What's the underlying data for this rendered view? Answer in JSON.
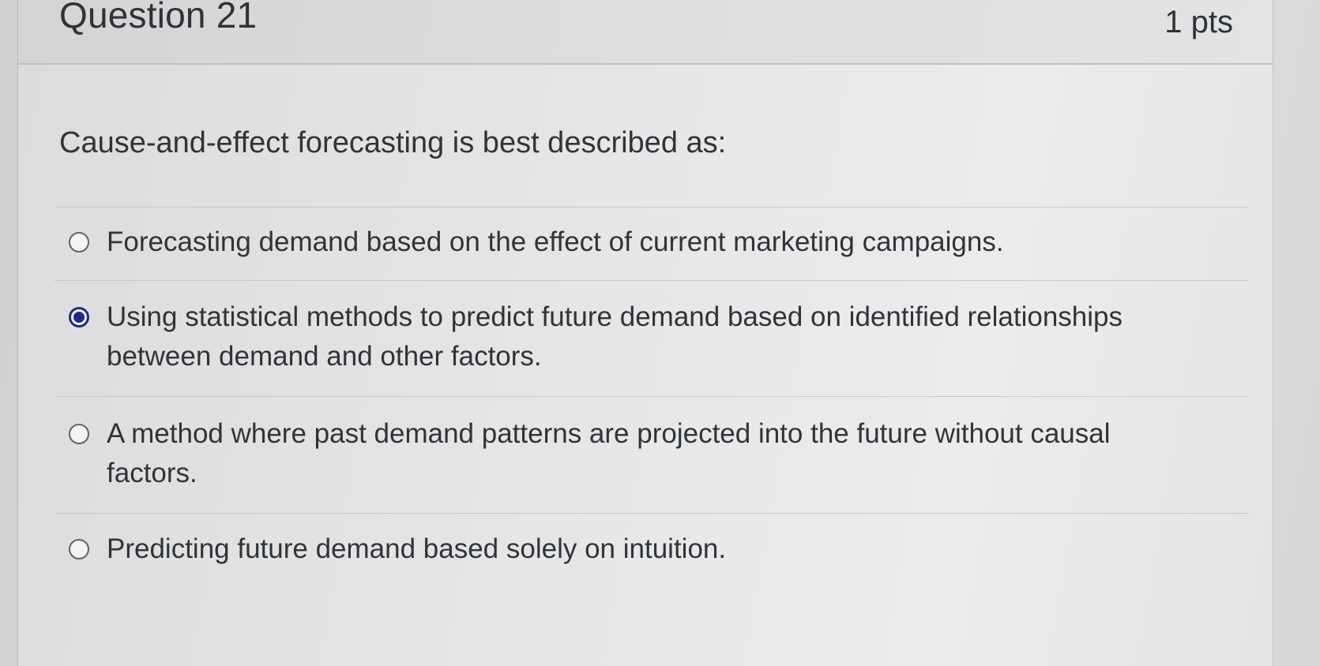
{
  "question": {
    "title": "Question 21",
    "points": "1 pts",
    "text": "Cause-and-effect forecasting is best described as:"
  },
  "answers": [
    {
      "label": "Forecasting demand based on the effect of current marketing campaigns.",
      "selected": false
    },
    {
      "label": "Using statistical methods to predict future demand based on identified relationships between demand and other factors.",
      "selected": true
    },
    {
      "label": "A method where past demand patterns are projected into the future without causal factors.",
      "selected": false
    },
    {
      "label": "Predicting future demand based solely on intuition.",
      "selected": false
    }
  ],
  "colors": {
    "selected_radio": "#1f2a8c",
    "text": "#2f3439"
  }
}
